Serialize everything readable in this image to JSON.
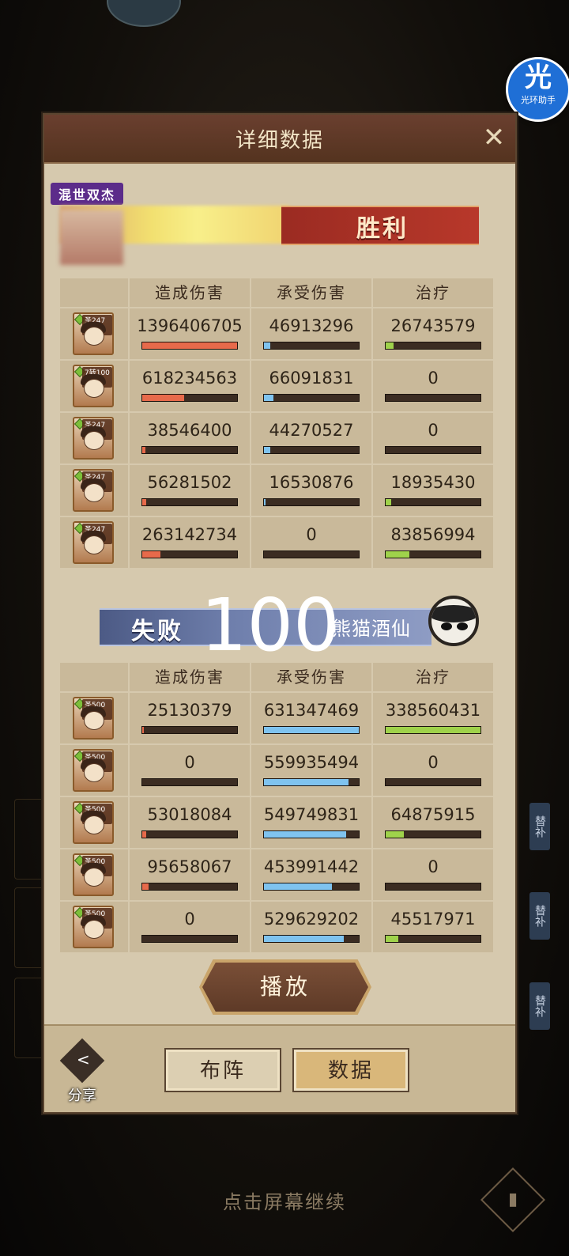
{
  "helper": {
    "icon_char": "光",
    "label": "光环助手"
  },
  "panel": {
    "title": "详细数据",
    "close_glyph": "✕"
  },
  "win_team": {
    "guild_tag": "混世双杰",
    "result": "胜利",
    "headers": [
      "造成伤害",
      "承受伤害",
      "治疗"
    ],
    "rows": [
      {
        "level": "圣247级",
        "dealt": "1396406705",
        "taken": "46913296",
        "heal": "26743579",
        "dealt_frac": 1.0,
        "taken_frac": 0.07,
        "heal_frac": 0.08
      },
      {
        "level": "7转100级",
        "dealt": "618234563",
        "taken": "66091831",
        "heal": "0",
        "dealt_frac": 0.44,
        "taken_frac": 0.1,
        "heal_frac": 0
      },
      {
        "level": "圣247级",
        "dealt": "38546400",
        "taken": "44270527",
        "heal": "0",
        "dealt_frac": 0.03,
        "taken_frac": 0.07,
        "heal_frac": 0
      },
      {
        "level": "圣247级",
        "dealt": "56281502",
        "taken": "16530876",
        "heal": "18935430",
        "dealt_frac": 0.04,
        "taken_frac": 0.02,
        "heal_frac": 0.06
      },
      {
        "level": "圣247级",
        "dealt": "263142734",
        "taken": "0",
        "heal": "83856994",
        "dealt_frac": 0.19,
        "taken_frac": 0,
        "heal_frac": 0.25
      }
    ]
  },
  "lose_team": {
    "result": "失败",
    "score": "100",
    "name": "熊猫酒仙",
    "headers": [
      "造成伤害",
      "承受伤害",
      "治疗"
    ],
    "rows": [
      {
        "level": "圣500级",
        "dealt": "25130379",
        "taken": "631347469",
        "heal": "338560431",
        "dealt_frac": 0.02,
        "taken_frac": 1.0,
        "heal_frac": 1.0
      },
      {
        "level": "圣500级",
        "dealt": "0",
        "taken": "559935494",
        "heal": "0",
        "dealt_frac": 0,
        "taken_frac": 0.89,
        "heal_frac": 0
      },
      {
        "level": "圣500级",
        "dealt": "53018084",
        "taken": "549749831",
        "heal": "64875915",
        "dealt_frac": 0.04,
        "taken_frac": 0.87,
        "heal_frac": 0.19
      },
      {
        "level": "圣500级",
        "dealt": "95658067",
        "taken": "453991442",
        "heal": "0",
        "dealt_frac": 0.07,
        "taken_frac": 0.72,
        "heal_frac": 0
      },
      {
        "level": "圣500级",
        "dealt": "0",
        "taken": "529629202",
        "heal": "45517971",
        "dealt_frac": 0,
        "taken_frac": 0.84,
        "heal_frac": 0.13
      }
    ]
  },
  "buttons": {
    "play": "播放",
    "formation": "布阵",
    "data": "数据",
    "share": "分享"
  },
  "footer": {
    "continue_hint": "点击屏幕继续"
  },
  "side_badges": [
    "替补",
    "替补",
    "替补"
  ],
  "colors": {
    "dealt": "#e76a4b",
    "taken": "#7fc3ef",
    "heal": "#9fd24b"
  }
}
